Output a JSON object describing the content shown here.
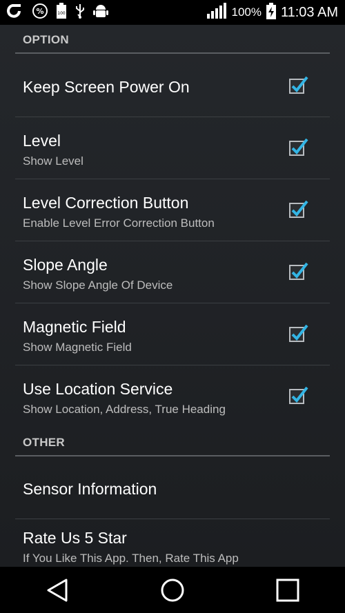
{
  "status_bar": {
    "battery_percent": "100%",
    "time": "11:03 AM",
    "icons": [
      "o-app-icon",
      "percent-icon",
      "battery-100-icon",
      "usb-icon",
      "android-debug-icon",
      "signal-icon",
      "battery-charging-icon"
    ]
  },
  "sections": {
    "option": {
      "label": "OPTION"
    },
    "other": {
      "label": "OTHER"
    }
  },
  "option_items": [
    {
      "title": "Keep Screen Power On",
      "subtitle": "",
      "checked": true
    },
    {
      "title": "Level",
      "subtitle": "Show Level",
      "checked": true
    },
    {
      "title": "Level Correction Button",
      "subtitle": "Enable Level Error Correction Button",
      "checked": true
    },
    {
      "title": "Slope Angle",
      "subtitle": "Show Slope Angle Of Device",
      "checked": true
    },
    {
      "title": "Magnetic Field",
      "subtitle": "Show Magnetic Field",
      "checked": true
    },
    {
      "title": "Use Location Service",
      "subtitle": "Show Location, Address, True Heading",
      "checked": true
    }
  ],
  "other_items": [
    {
      "title": "Sensor Information",
      "subtitle": ""
    },
    {
      "title": "Rate Us 5 Star",
      "subtitle": "If You Like This App. Then, Rate This App"
    }
  ],
  "colors": {
    "accent_check": "#33b5e5",
    "background": "#1f2124",
    "bars": "#000000"
  },
  "navigation": {
    "icons": [
      "back-icon",
      "home-icon",
      "recents-icon"
    ]
  }
}
